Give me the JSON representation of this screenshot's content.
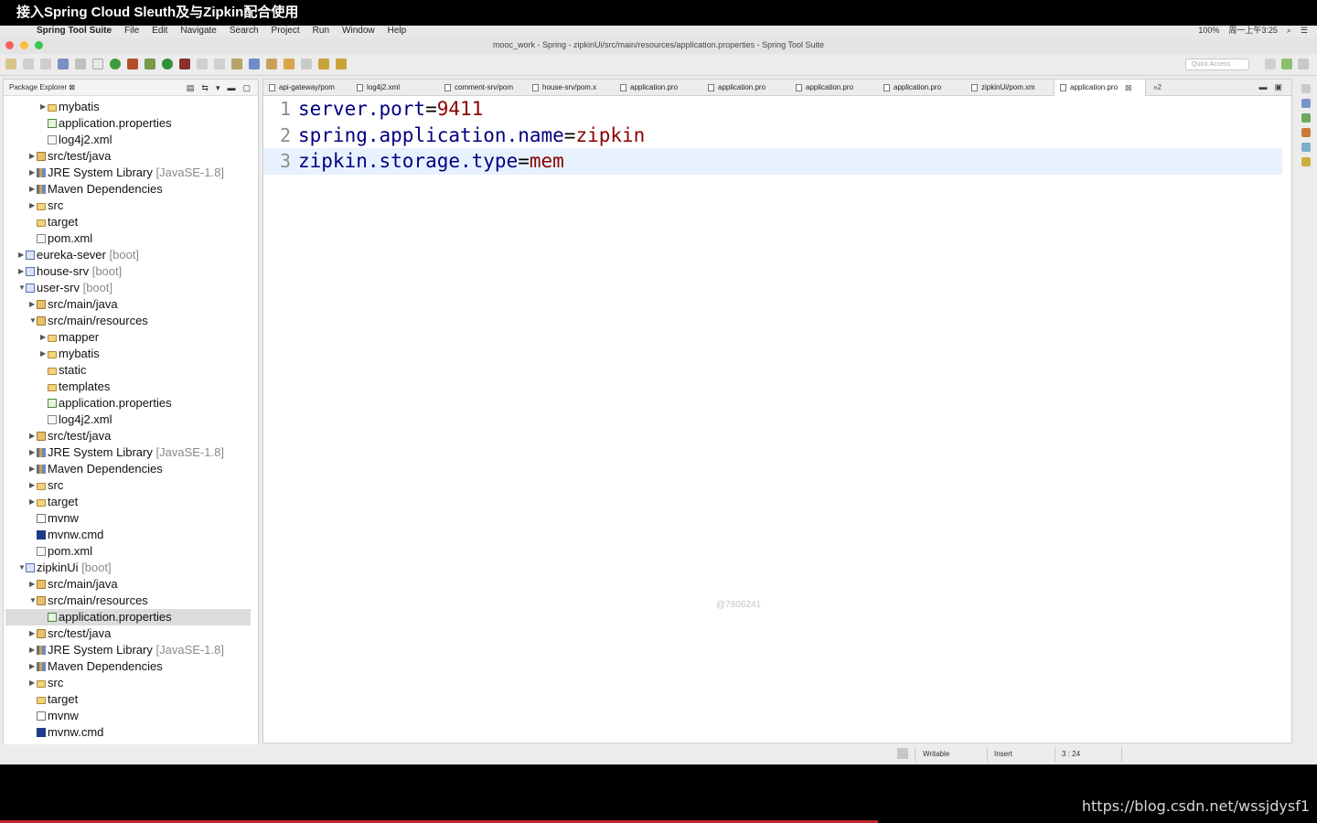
{
  "video": {
    "title": "接入Spring Cloud Sleuth及与Zipkin配合使用",
    "watermark_url": "https://blog.csdn.net/wssjdysf1",
    "progress": 0.667
  },
  "menubar": {
    "app_name": "Spring Tool Suite",
    "items": [
      "File",
      "Edit",
      "Navigate",
      "Search",
      "Project",
      "Run",
      "Window",
      "Help"
    ],
    "battery": "100%",
    "clock": "周一上午3:25"
  },
  "window": {
    "title": "mooc_work - Spring - zipkinUi/src/main/resources/application.properties - Spring Tool Suite",
    "traffic_colors": [
      "#fc605c",
      "#fdbc40",
      "#34c84a"
    ]
  },
  "toolbar": {
    "quick_access_placeholder": "Quick Access"
  },
  "explorer": {
    "title": "Package Explorer",
    "close_glyph": "⊠",
    "rows": [
      {
        "indent": 3,
        "expanded": false,
        "icon": "folder",
        "label": "mybatis",
        "tag": ""
      },
      {
        "indent": 3,
        "expanded": null,
        "icon": "props",
        "label": "application.properties",
        "tag": ""
      },
      {
        "indent": 3,
        "expanded": null,
        "icon": "xml",
        "label": "log4j2.xml",
        "tag": ""
      },
      {
        "indent": 2,
        "expanded": false,
        "icon": "pkgfolder",
        "label": "src/test/java",
        "tag": ""
      },
      {
        "indent": 2,
        "expanded": false,
        "icon": "lib",
        "label": "JRE System Library",
        "tag": "[JavaSE-1.8]"
      },
      {
        "indent": 2,
        "expanded": false,
        "icon": "lib",
        "label": "Maven Dependencies",
        "tag": ""
      },
      {
        "indent": 2,
        "expanded": false,
        "icon": "folder",
        "label": "src",
        "tag": ""
      },
      {
        "indent": 2,
        "expanded": null,
        "icon": "folder",
        "label": "target",
        "tag": ""
      },
      {
        "indent": 2,
        "expanded": null,
        "icon": "xml",
        "label": "pom.xml",
        "tag": ""
      },
      {
        "indent": 1,
        "expanded": false,
        "icon": "project",
        "label": "eureka-sever",
        "tag": "[boot]"
      },
      {
        "indent": 1,
        "expanded": false,
        "icon": "project",
        "label": "house-srv",
        "tag": "[boot]"
      },
      {
        "indent": 1,
        "expanded": true,
        "icon": "project",
        "label": "user-srv",
        "tag": "[boot]"
      },
      {
        "indent": 2,
        "expanded": false,
        "icon": "pkgfolder",
        "label": "src/main/java",
        "tag": ""
      },
      {
        "indent": 2,
        "expanded": true,
        "icon": "pkgfolder",
        "label": "src/main/resources",
        "tag": ""
      },
      {
        "indent": 3,
        "expanded": false,
        "icon": "folder",
        "label": "mapper",
        "tag": ""
      },
      {
        "indent": 3,
        "expanded": false,
        "icon": "folder",
        "label": "mybatis",
        "tag": ""
      },
      {
        "indent": 3,
        "expanded": null,
        "icon": "folder",
        "label": "static",
        "tag": ""
      },
      {
        "indent": 3,
        "expanded": null,
        "icon": "folder",
        "label": "templates",
        "tag": ""
      },
      {
        "indent": 3,
        "expanded": null,
        "icon": "props",
        "label": "application.properties",
        "tag": ""
      },
      {
        "indent": 3,
        "expanded": null,
        "icon": "xml",
        "label": "log4j2.xml",
        "tag": ""
      },
      {
        "indent": 2,
        "expanded": false,
        "icon": "pkgfolder",
        "label": "src/test/java",
        "tag": ""
      },
      {
        "indent": 2,
        "expanded": false,
        "icon": "lib",
        "label": "JRE System Library",
        "tag": "[JavaSE-1.8]"
      },
      {
        "indent": 2,
        "expanded": false,
        "icon": "lib",
        "label": "Maven Dependencies",
        "tag": ""
      },
      {
        "indent": 2,
        "expanded": false,
        "icon": "folder",
        "label": "src",
        "tag": ""
      },
      {
        "indent": 2,
        "expanded": false,
        "icon": "folder",
        "label": "target",
        "tag": ""
      },
      {
        "indent": 2,
        "expanded": null,
        "icon": "file",
        "label": "mvnw",
        "tag": ""
      },
      {
        "indent": 2,
        "expanded": null,
        "icon": "cmd",
        "label": "mvnw.cmd",
        "tag": ""
      },
      {
        "indent": 2,
        "expanded": null,
        "icon": "xml",
        "label": "pom.xml",
        "tag": ""
      },
      {
        "indent": 1,
        "expanded": true,
        "icon": "project",
        "label": "zipkinUi",
        "tag": "[boot]"
      },
      {
        "indent": 2,
        "expanded": false,
        "icon": "pkgfolder",
        "label": "src/main/java",
        "tag": ""
      },
      {
        "indent": 2,
        "expanded": true,
        "icon": "pkgfolder",
        "label": "src/main/resources",
        "tag": ""
      },
      {
        "indent": 3,
        "expanded": null,
        "icon": "props",
        "label": "application.properties",
        "tag": "",
        "selected": true
      },
      {
        "indent": 2,
        "expanded": false,
        "icon": "pkgfolder",
        "label": "src/test/java",
        "tag": ""
      },
      {
        "indent": 2,
        "expanded": false,
        "icon": "lib",
        "label": "JRE System Library",
        "tag": "[JavaSE-1.8]"
      },
      {
        "indent": 2,
        "expanded": false,
        "icon": "lib",
        "label": "Maven Dependencies",
        "tag": ""
      },
      {
        "indent": 2,
        "expanded": false,
        "icon": "folder",
        "label": "src",
        "tag": ""
      },
      {
        "indent": 2,
        "expanded": null,
        "icon": "folder",
        "label": "target",
        "tag": ""
      },
      {
        "indent": 2,
        "expanded": null,
        "icon": "file",
        "label": "mvnw",
        "tag": ""
      },
      {
        "indent": 2,
        "expanded": null,
        "icon": "cmd",
        "label": "mvnw.cmd",
        "tag": ""
      }
    ]
  },
  "editor": {
    "tabs": [
      {
        "label": "api-gateway/pom",
        "active": false
      },
      {
        "label": "log4j2.xml",
        "active": false
      },
      {
        "label": "comment-srv/pom",
        "active": false
      },
      {
        "label": "house-srv/pom.x",
        "active": false
      },
      {
        "label": "application.pro",
        "active": false
      },
      {
        "label": "application.pro",
        "active": false
      },
      {
        "label": "application.pro",
        "active": false
      },
      {
        "label": "application.pro",
        "active": false
      },
      {
        "label": "zipkinUi/pom.xm",
        "active": false
      },
      {
        "label": "application.pro",
        "active": true
      }
    ],
    "overflow_label": "»2",
    "lines": [
      {
        "num": "1",
        "key": "server.port",
        "value": "9411"
      },
      {
        "num": "2",
        "key": "spring.application.name",
        "value": "zipkin"
      },
      {
        "num": "3",
        "key": "zipkin.storage.type",
        "value": "mem"
      }
    ],
    "current_line": 3,
    "watermark": "@7806241"
  },
  "status": {
    "writable": "Writable",
    "insert_mode": "Insert",
    "position": "3 : 24"
  }
}
